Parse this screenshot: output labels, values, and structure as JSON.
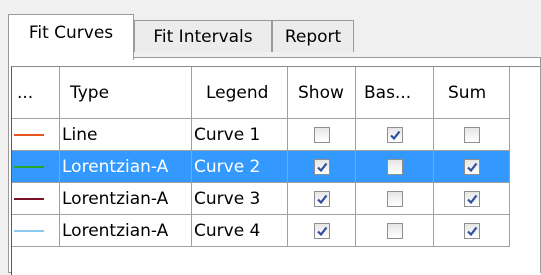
{
  "tabs": [
    {
      "label": "Fit Curves",
      "active": true
    },
    {
      "label": "Fit Intervals",
      "active": false
    },
    {
      "label": "Report",
      "active": false
    }
  ],
  "table": {
    "headers": [
      "...",
      "Type",
      "Legend",
      "Show",
      "Bas...",
      "Sum"
    ],
    "rows": [
      {
        "color": "#e8541c",
        "type": "Line",
        "legend": "Curve 1",
        "show": false,
        "baseline": true,
        "sum": false,
        "selected": false
      },
      {
        "color": "#27a627",
        "type": "Lorentzian-A",
        "legend": "Curve 2",
        "show": true,
        "baseline": false,
        "sum": true,
        "selected": true
      },
      {
        "color": "#7a1026",
        "type": "Lorentzian-A",
        "legend": "Curve 3",
        "show": true,
        "baseline": false,
        "sum": true,
        "selected": false
      },
      {
        "color": "#8cc8f0",
        "type": "Lorentzian-A",
        "legend": "Curve 4",
        "show": true,
        "baseline": false,
        "sum": true,
        "selected": false
      }
    ]
  }
}
